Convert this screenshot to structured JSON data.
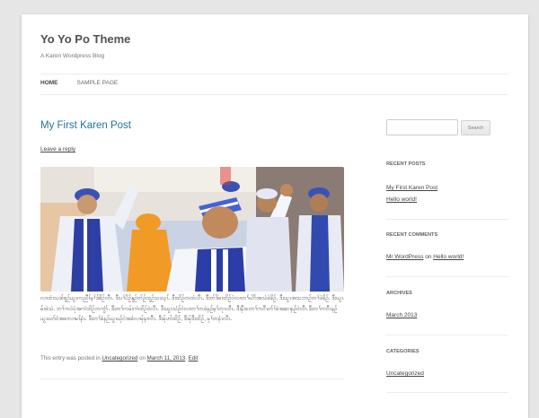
{
  "site": {
    "title": "Yo Yo Po Theme",
    "description": "A Karen Wordpress Blog"
  },
  "nav": {
    "items": [
      "HOME",
      "SAMPLE PAGE"
    ]
  },
  "post": {
    "title": "My First Karen Post",
    "leave_reply": "Leave a reply",
    "body": "လၢထံးသးစ်စူဉ်ယွၤကညီၤ်မ့ၢ်ဒ်စိဉ်လီၤ. ဒီးပၢ်ပိဉ်နူဉ်တ်ဉ်ထူဉ်သးဃ့ၤ်. ဒီးထိဉ်တထံလီၤ. ဒီးတ်ဒိဖးထိဉ်ဝဲလၢတၢ်ဃိာ်အသံဖဲခိဉ်, ဒီးယွၤအသးဘဉ်တၢ်ဖဲခိဉ်. ဒီးယွၤမ်းဖဲသဲ. ဘၢ်ကဝဲပုံအကဲထိဉ်ဘကွံာ်. ဒီးတၢ်ကမ်းကဲထိဉ်ဝဲလီၤ. ဒီးယွၤသံဉ်ဝဲလၢတၢ်ကဖဲနဉ်မ့ၢ်တုၤလီၤ. ဒီးနီးဖးဘၢ်ကဝီၤတ်ၢ်ဖဲအဆၢနဉ်ဝဲလီၤ.ဒီးတၢ်ကဝီၤနဉ်ယွၤဃာ်ဝဲအဖၢလၢမၤ်နံၤ. ဒီးတၢ်ခံနဉ်ယွၤဃှ်ဝဲအခံလၢမှ်နၢလီၤ. ဒီးမှ်ဟါထိဉ်, ဒီးမှ်ဒီးထိဉ်, မုၢ်တနံၤလီၤ.",
    "meta_prefix": "This entry was posted in ",
    "category": "Uncategorized",
    "meta_on": " on ",
    "date": "March 11, 2013",
    "meta_sep": ". ",
    "edit": "Edit"
  },
  "sidebar": {
    "search_placeholder": "",
    "search_button": "Search",
    "recent_posts_title": "RECENT POSTS",
    "recent_posts": [
      "My First Karen Post",
      "Hello world!"
    ],
    "recent_comments_title": "RECENT COMMENTS",
    "comment_author": "Mr WordPress",
    "comment_on": " on ",
    "comment_post": "Hello world!",
    "archives_title": "ARCHIVES",
    "archives": [
      "March 2013"
    ],
    "categories_title": "CATEGORIES",
    "categories": [
      "Uncategorized"
    ]
  },
  "colors": {
    "link": "#21759b",
    "background": "#e6e6e6"
  }
}
